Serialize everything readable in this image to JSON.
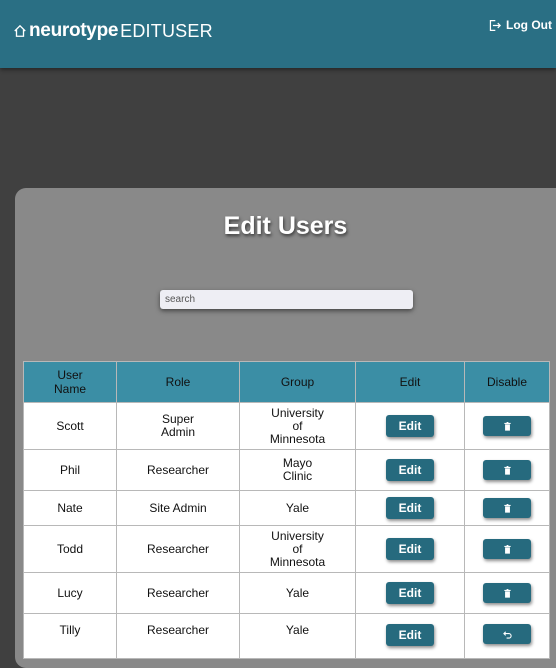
{
  "header": {
    "brand": "neurotype",
    "page_label": "EDITUSER",
    "logout_label": "Log Out"
  },
  "main": {
    "title": "Edit Users",
    "search_placeholder": "search"
  },
  "table": {
    "columns": [
      "User Name",
      "Role",
      "Group",
      "Edit",
      "Disable"
    ],
    "rows": [
      {
        "name": "Scott",
        "role": "Super Admin",
        "group": "University of Minnesota",
        "edit": "Edit",
        "action": "trash-icon"
      },
      {
        "name": "Phil",
        "role": "Researcher",
        "group": "Mayo Clinic",
        "edit": "Edit",
        "action": "trash-icon"
      },
      {
        "name": "Nate",
        "role": "Site Admin",
        "group": "Yale",
        "edit": "Edit",
        "action": "trash-icon"
      },
      {
        "name": "Todd",
        "role": "Researcher",
        "group": "University of Minnesota",
        "edit": "Edit",
        "action": "trash-icon"
      },
      {
        "name": "Lucy",
        "role": "Researcher",
        "group": "Yale",
        "edit": "Edit",
        "action": "trash-icon"
      },
      {
        "name": "Tilly",
        "role": "Researcher",
        "group": "Yale",
        "edit": "Edit",
        "action": "undo-icon"
      }
    ]
  },
  "colors": {
    "header": "#2a6f84",
    "table_header": "#3b8ea5",
    "button": "#266a7e",
    "panel": "#898989",
    "background": "#404040"
  }
}
